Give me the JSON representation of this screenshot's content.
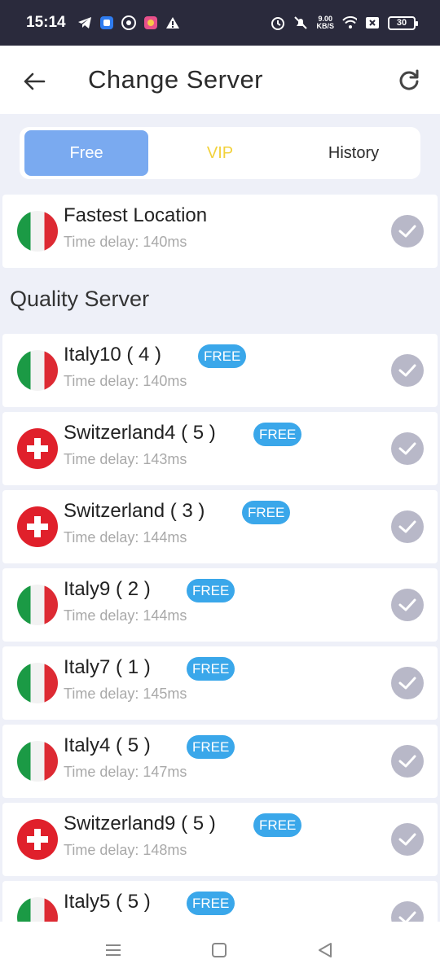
{
  "status_bar": {
    "time": "15:14",
    "left_icons": [
      "telegram-icon",
      "app-icon",
      "chrome-icon",
      "app-icon-2",
      "warning-icon"
    ],
    "net_speed_value": "9.00",
    "net_speed_unit": "KB/S",
    "battery": "30"
  },
  "header": {
    "title": "Change Server"
  },
  "tabs": [
    {
      "label": "Free",
      "active": true
    },
    {
      "label": "VIP",
      "active": false
    },
    {
      "label": "History",
      "active": false
    }
  ],
  "fastest": {
    "name": "Fastest Location",
    "delay": "Time delay: 140ms",
    "flag": "italy"
  },
  "section_title": "Quality Server",
  "servers": [
    {
      "name": "Italy10 ( 4 )",
      "badge": "FREE",
      "delay": "Time delay: 140ms",
      "flag": "italy"
    },
    {
      "name": "Switzerland4 ( 5 )",
      "badge": "FREE",
      "delay": "Time delay: 143ms",
      "flag": "switzerland"
    },
    {
      "name": "Switzerland ( 3 )",
      "badge": "FREE",
      "delay": "Time delay: 144ms",
      "flag": "switzerland"
    },
    {
      "name": "Italy9 ( 2 )",
      "badge": "FREE",
      "delay": "Time delay: 144ms",
      "flag": "italy"
    },
    {
      "name": "Italy7 ( 1 )",
      "badge": "FREE",
      "delay": "Time delay: 145ms",
      "flag": "italy"
    },
    {
      "name": "Italy4 ( 5 )",
      "badge": "FREE",
      "delay": "Time delay: 147ms",
      "flag": "italy"
    },
    {
      "name": "Switzerland9 ( 5 )",
      "badge": "FREE",
      "delay": "Time delay: 148ms",
      "flag": "switzerland"
    },
    {
      "name": "Italy5 ( 5 )",
      "badge": "FREE",
      "delay": "",
      "flag": "italy"
    }
  ],
  "colors": {
    "accent_tab": "#7aaaf0",
    "vip": "#f2d23c",
    "badge": "#3aa7ea",
    "check": "#b8b8c8"
  }
}
